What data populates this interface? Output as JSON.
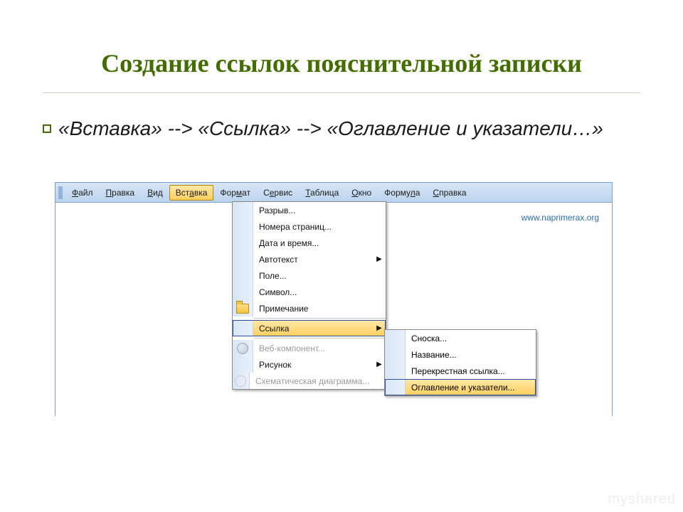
{
  "title": "Создание ссылок пояснительной записки",
  "bullet": "«Вставка» --> «Ссылка» --> «Оглавление и указатели…»",
  "url_overlay": "www.naprimerax.org",
  "menubar": {
    "items": [
      {
        "html": "<u>Ф</u>айл"
      },
      {
        "html": "<u>П</u>равка"
      },
      {
        "html": "<u>В</u>ид"
      },
      {
        "html": "Вст<u>а</u>вка"
      },
      {
        "html": "Фор<u>м</u>ат"
      },
      {
        "html": "С<u>е</u>рвис"
      },
      {
        "html": "<u>Т</u>аблица"
      },
      {
        "html": "<u>О</u>кно"
      },
      {
        "html": "Форму<u>л</u>а"
      },
      {
        "html": "<u>С</u>правка"
      }
    ],
    "open_index": 3
  },
  "dropdown": {
    "items": [
      {
        "label": "Разрыв...",
        "icon": "",
        "arrow": false,
        "disabled": false
      },
      {
        "label": "Номера страниц...",
        "icon": "",
        "arrow": false,
        "disabled": false
      },
      {
        "label": "Дата и время...",
        "icon": "",
        "arrow": false,
        "disabled": false
      },
      {
        "label": "Автотекст",
        "icon": "",
        "arrow": true,
        "disabled": false
      },
      {
        "label": "Поле...",
        "icon": "",
        "arrow": false,
        "disabled": false
      },
      {
        "label": "Символ...",
        "icon": "",
        "arrow": false,
        "disabled": false
      },
      {
        "label": "Примечание",
        "icon": "folder",
        "arrow": false,
        "disabled": false
      },
      {
        "sep": true
      },
      {
        "label": "Ссылка",
        "icon": "",
        "arrow": true,
        "disabled": false,
        "selected": true
      },
      {
        "sep": true
      },
      {
        "label": "Веб-компонент...",
        "icon": "globe",
        "arrow": false,
        "disabled": true
      },
      {
        "label": "Рисунок",
        "icon": "",
        "arrow": true,
        "disabled": false
      },
      {
        "label": "Схематическая диаграмма...",
        "icon": "chart",
        "arrow": false,
        "disabled": true
      }
    ]
  },
  "submenu": {
    "items": [
      {
        "label": "Сноска..."
      },
      {
        "label": "Название..."
      },
      {
        "label": "Перекрестная ссылка..."
      },
      {
        "label": "Оглавление и указатели...",
        "selected": true
      }
    ]
  },
  "watermark": "myshared"
}
